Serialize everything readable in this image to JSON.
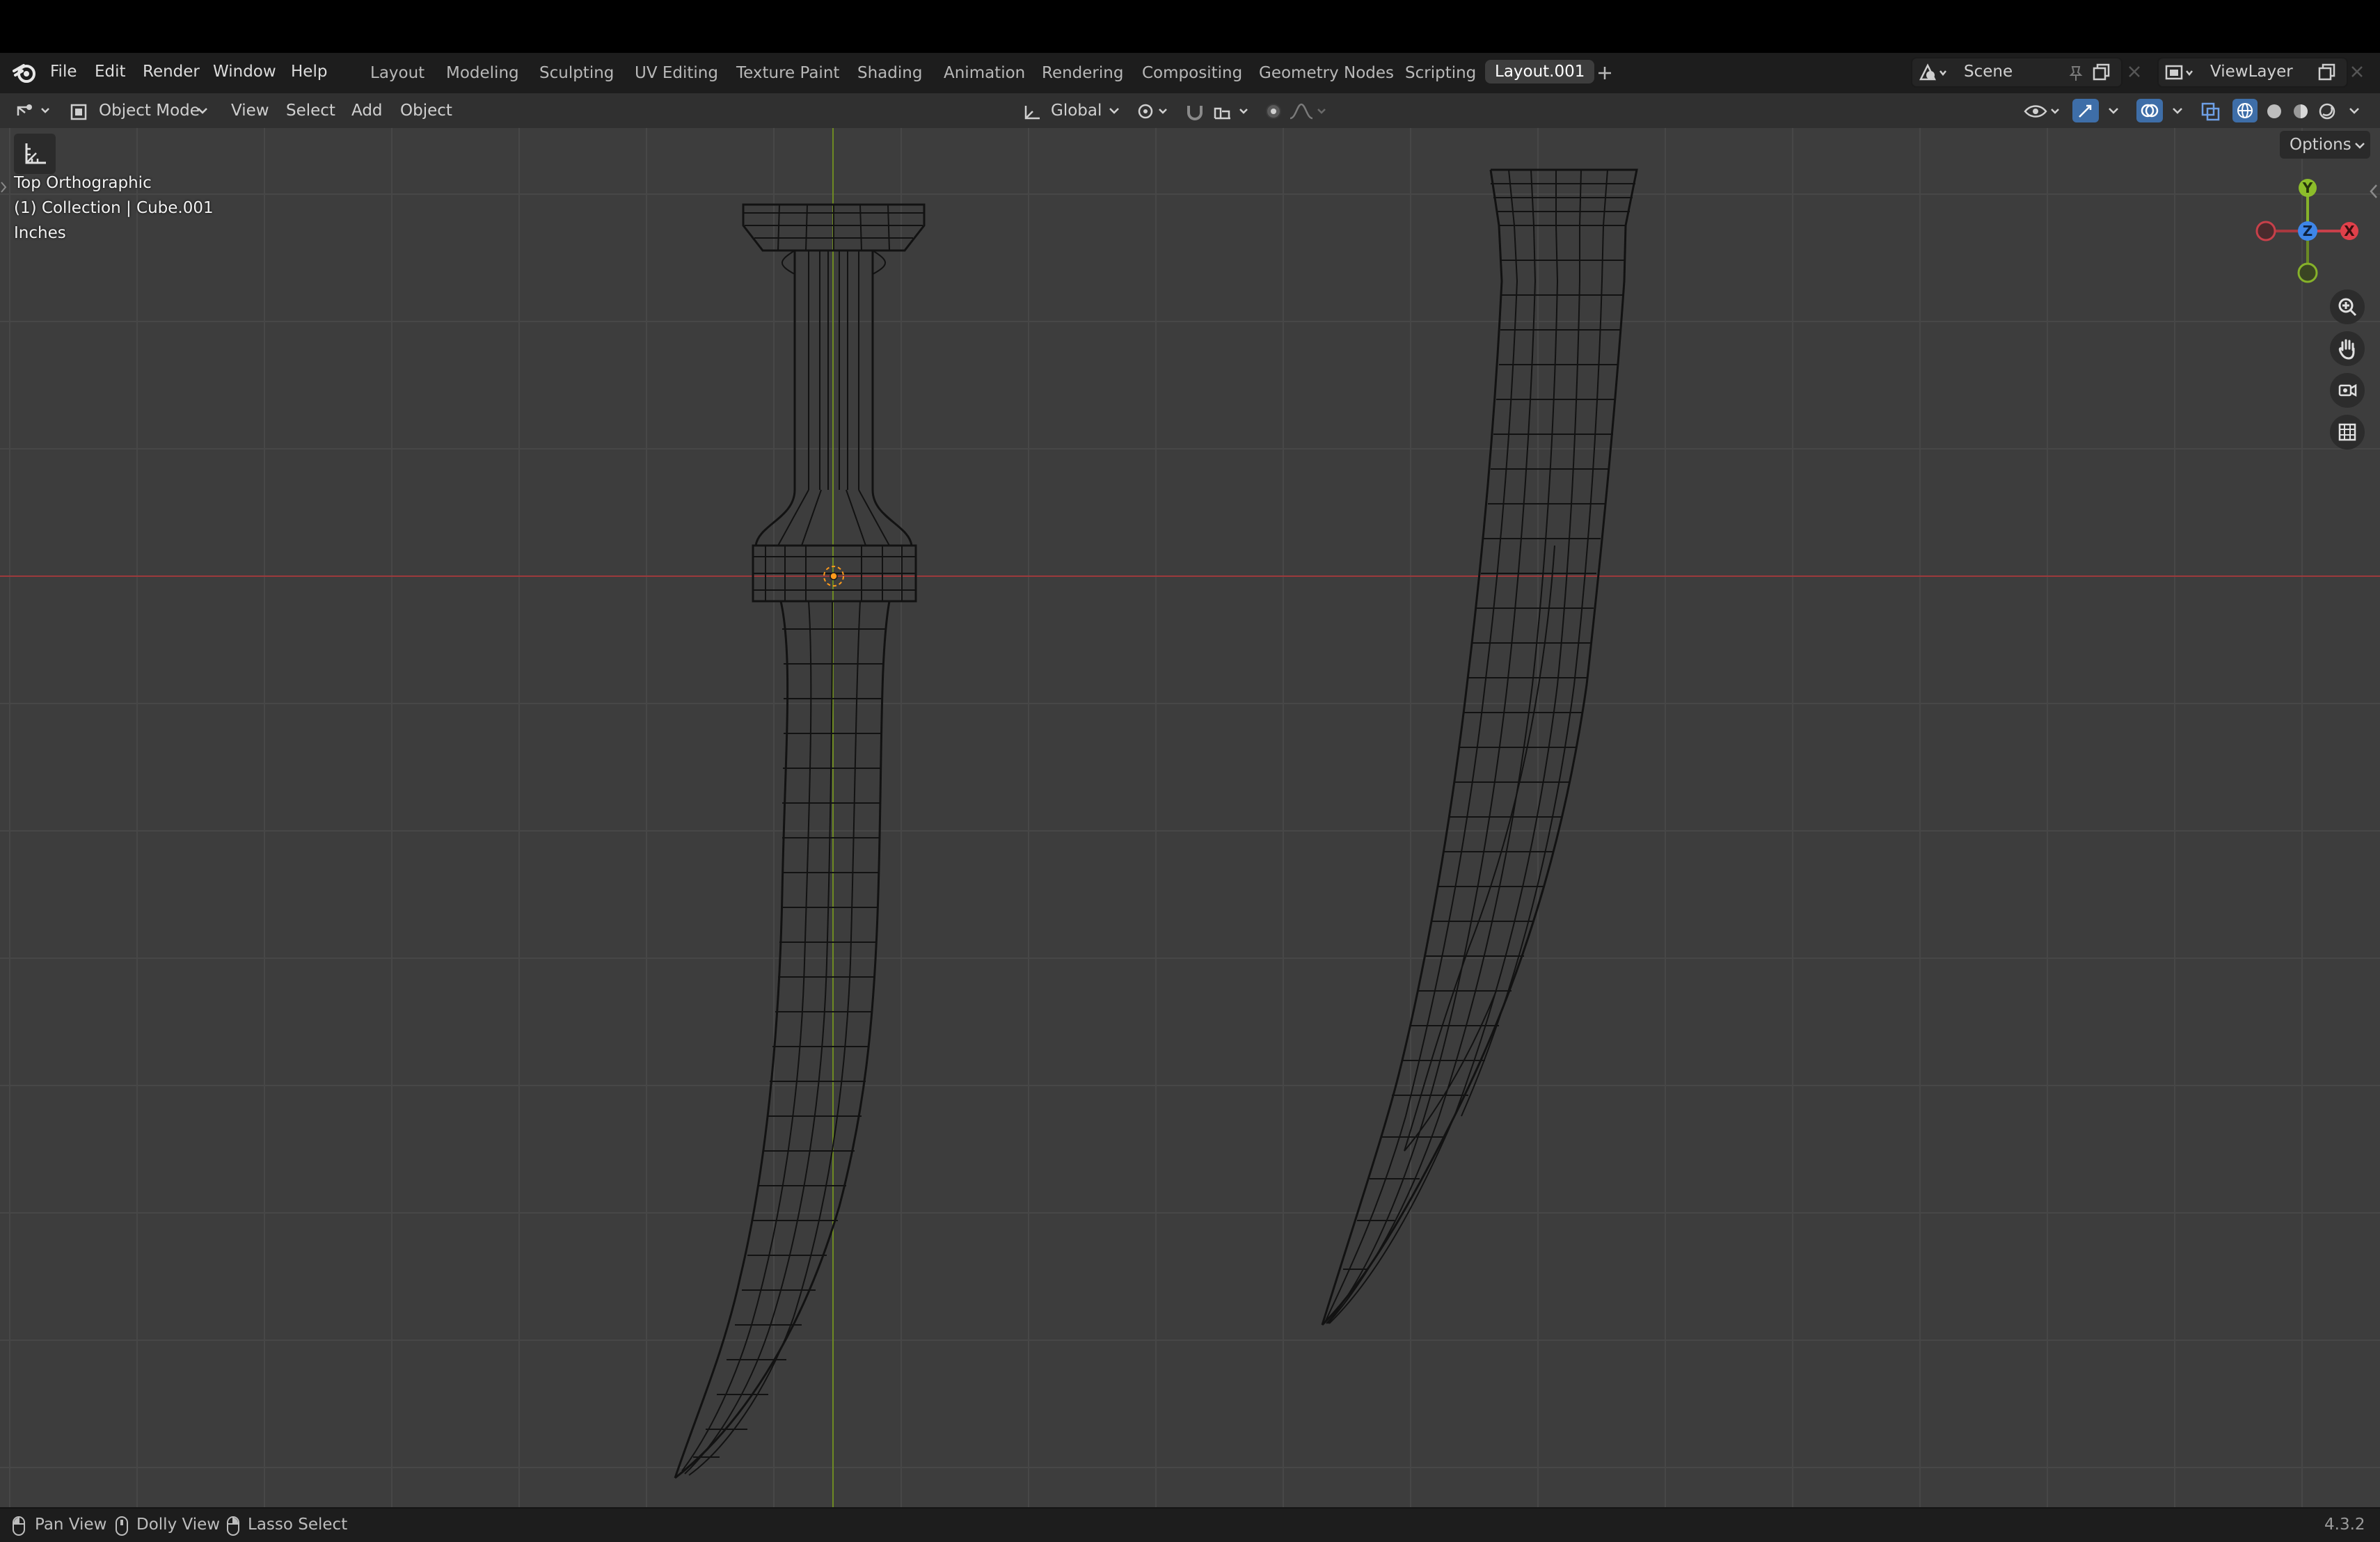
{
  "top_menu": {
    "items": [
      "File",
      "Edit",
      "Render",
      "Window",
      "Help"
    ]
  },
  "workspaces": {
    "tabs": [
      "Layout",
      "Modeling",
      "Sculpting",
      "UV Editing",
      "Texture Paint",
      "Shading",
      "Animation",
      "Rendering",
      "Compositing",
      "Geometry Nodes",
      "Scripting",
      "Layout.001"
    ],
    "active": "Layout.001",
    "add_icon": "plus-icon"
  },
  "scene": {
    "label": "Scene"
  },
  "view_layer": {
    "label": "ViewLayer"
  },
  "header": {
    "mode": "Object Mode",
    "menus": [
      "View",
      "Select",
      "Add",
      "Object"
    ],
    "orientation": "Global",
    "options": "Options"
  },
  "viewport": {
    "view_name": "Top Orthographic",
    "collection": "(1) Collection | Cube.001",
    "units": "Inches"
  },
  "gizmo": {
    "y": "Y",
    "z": "Z",
    "x": "X"
  },
  "statusbar": {
    "items": [
      "Pan View",
      "Dolly View",
      "Lasso Select"
    ],
    "version": "4.3.2"
  },
  "colors": {
    "x_axis": "#e0404a",
    "y_axis": "#8cbd2a",
    "z_axis": "#3e86e8",
    "origin": "#ff9a1c",
    "viewport_bg": "#3d3d3d",
    "active_button": "#3e6ea8"
  }
}
